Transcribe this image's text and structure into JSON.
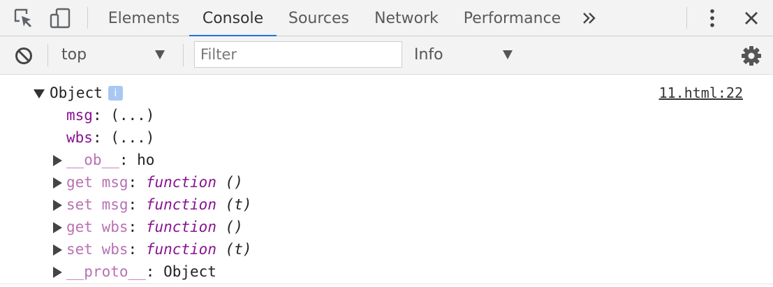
{
  "tabbar": {
    "icons": {
      "inspect": "inspect-element-icon",
      "device": "device-toolbar-icon",
      "more_tabs": "chevron-double-right-icon",
      "menu": "kebab-menu-icon",
      "close": "close-icon"
    },
    "tabs": [
      {
        "label": "Elements"
      },
      {
        "label": "Console",
        "active": true
      },
      {
        "label": "Sources"
      },
      {
        "label": "Network"
      },
      {
        "label": "Performance"
      }
    ],
    "accent_color": "#1a73e8"
  },
  "toolbar": {
    "clear_icon": "no-entry-icon",
    "context": "top",
    "filter_placeholder": "Filter",
    "filter_value": "",
    "level": "Info",
    "settings_icon": "gear-icon"
  },
  "console": {
    "object_label": "Object",
    "info_badge": "i",
    "source": "11.html:22",
    "props": [
      {
        "key": "msg",
        "colon": ":",
        "value": " (...)"
      },
      {
        "key": "wbs",
        "colon": ":",
        "value": " (...)"
      }
    ],
    "ob": {
      "key": "__ob__",
      "colon": ":",
      "value": " ho"
    },
    "accessors": [
      {
        "key": "get msg",
        "colon": ":",
        "fn": "function",
        "args": " ()"
      },
      {
        "key": "set msg",
        "colon": ":",
        "fn": "function",
        "args": " (t)"
      },
      {
        "key": "get wbs",
        "colon": ":",
        "fn": "function",
        "args": " ()"
      },
      {
        "key": "set wbs",
        "colon": ":",
        "fn": "function",
        "args": " (t)"
      }
    ],
    "proto": {
      "key": "__proto__",
      "colon": ":",
      "value": " Object"
    }
  }
}
